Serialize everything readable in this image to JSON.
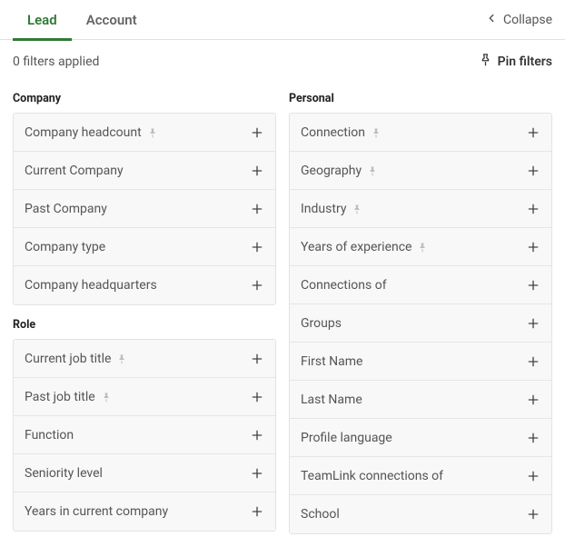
{
  "tabs": {
    "lead": "Lead",
    "account": "Account"
  },
  "collapse_label": "Collapse",
  "filters_applied_text": "0 filters applied",
  "pin_filters_label": "Pin filters",
  "groups": {
    "company": {
      "title": "Company",
      "items": [
        {
          "label": "Company headcount",
          "pinned": true
        },
        {
          "label": "Current Company",
          "pinned": false
        },
        {
          "label": "Past Company",
          "pinned": false
        },
        {
          "label": "Company type",
          "pinned": false
        },
        {
          "label": "Company headquarters",
          "pinned": false
        }
      ]
    },
    "role": {
      "title": "Role",
      "items": [
        {
          "label": "Current job title",
          "pinned": true
        },
        {
          "label": "Past job title",
          "pinned": true
        },
        {
          "label": "Function",
          "pinned": false
        },
        {
          "label": "Seniority level",
          "pinned": false
        },
        {
          "label": "Years in current company",
          "pinned": false
        }
      ]
    },
    "personal": {
      "title": "Personal",
      "items": [
        {
          "label": "Connection",
          "pinned": true
        },
        {
          "label": "Geography",
          "pinned": true
        },
        {
          "label": "Industry",
          "pinned": true
        },
        {
          "label": "Years of experience",
          "pinned": true
        },
        {
          "label": "Connections of",
          "pinned": false
        },
        {
          "label": "Groups",
          "pinned": false
        },
        {
          "label": "First Name",
          "pinned": false
        },
        {
          "label": "Last Name",
          "pinned": false
        },
        {
          "label": "Profile language",
          "pinned": false
        },
        {
          "label": "TeamLink connections of",
          "pinned": false
        },
        {
          "label": "School",
          "pinned": false
        }
      ]
    }
  }
}
